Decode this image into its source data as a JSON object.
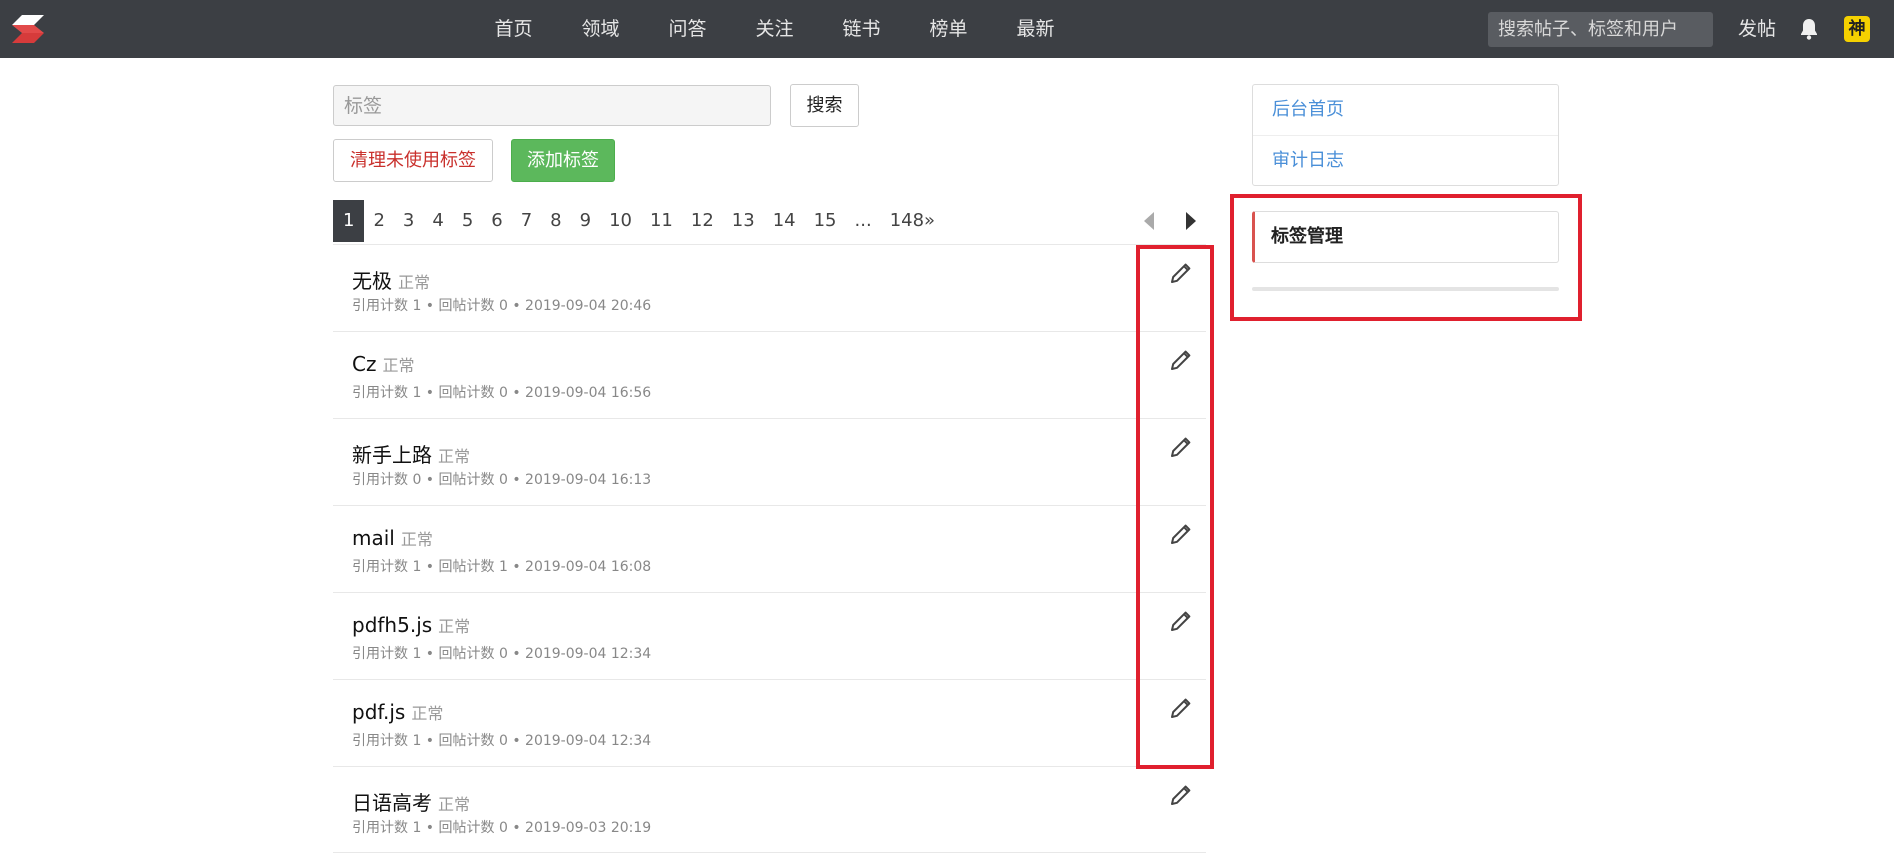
{
  "nav": {
    "items": [
      "首页",
      "领域",
      "问答",
      "关注",
      "链书",
      "榜单",
      "最新"
    ],
    "search_placeholder": "搜索帖子、标签和用户",
    "post_label": "发帖",
    "avatar_text": "神"
  },
  "toolbar": {
    "tag_placeholder": "标签",
    "search_label": "搜索",
    "clean_label": "清理未使用标签",
    "add_label": "添加标签"
  },
  "pagination": {
    "pages": [
      "1",
      "2",
      "3",
      "4",
      "5",
      "6",
      "7",
      "8",
      "9",
      "10",
      "11",
      "12",
      "13",
      "14",
      "15",
      "...",
      "148»"
    ],
    "active": "1"
  },
  "tags": [
    {
      "name": "无极",
      "status": "正常",
      "meta": "引用计数 1 • 回帖计数 0 • 2019-09-04 20:46"
    },
    {
      "name": "Cz",
      "status": "正常",
      "meta": "引用计数 1 • 回帖计数 0 • 2019-09-04 16:56"
    },
    {
      "name": "新手上路",
      "status": "正常",
      "meta": "引用计数 0 • 回帖计数 0 • 2019-09-04 16:13"
    },
    {
      "name": "mail",
      "status": "正常",
      "meta": "引用计数 1 • 回帖计数 1 • 2019-09-04 16:08"
    },
    {
      "name": "pdfh5.js",
      "status": "正常",
      "meta": "引用计数 1 • 回帖计数 0 • 2019-09-04 12:34"
    },
    {
      "name": "pdf.js",
      "status": "正常",
      "meta": "引用计数 1 • 回帖计数 0 • 2019-09-04 12:34"
    },
    {
      "name": "日语高考",
      "status": "正常",
      "meta": "引用计数 1 • 回帖计数 0 • 2019-09-03 20:19"
    }
  ],
  "sidebar": {
    "links": [
      "后台首页",
      "审计日志"
    ],
    "active": "标签管理"
  },
  "colors": {
    "topbar": "#3c3f44",
    "link": "#4a8fd8",
    "danger": "#c9302c",
    "success": "#5cb85c",
    "highlight": "#e0202e"
  }
}
